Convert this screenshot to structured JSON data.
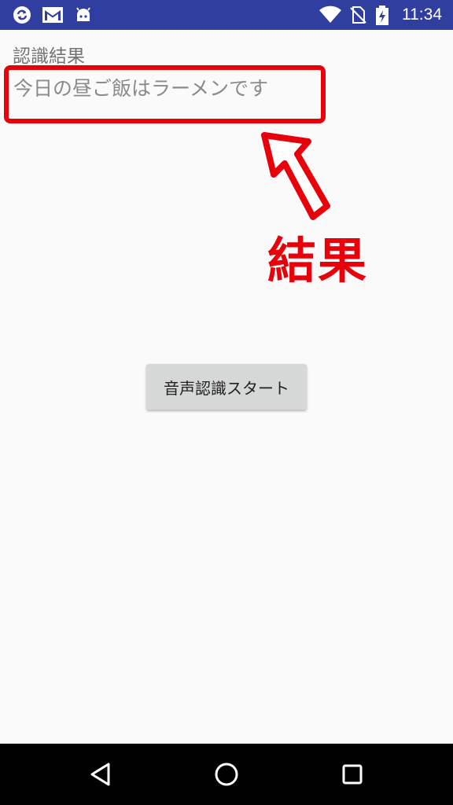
{
  "status_bar": {
    "time": "11:34",
    "color": "#303f9f",
    "icons": [
      "sync-icon",
      "gmail-icon",
      "android-debug-icon",
      "wifi-icon",
      "no-sim-icon",
      "battery-charging-icon"
    ]
  },
  "main": {
    "result_label": "認識結果",
    "result_text": "今日の昼ご飯はラーメンです",
    "start_button_label": "音声認識スタート"
  },
  "annotation": {
    "label": "結果",
    "color": "#e8000b"
  },
  "nav_bar": {
    "icons": [
      "back-icon",
      "home-icon",
      "recents-icon"
    ]
  }
}
